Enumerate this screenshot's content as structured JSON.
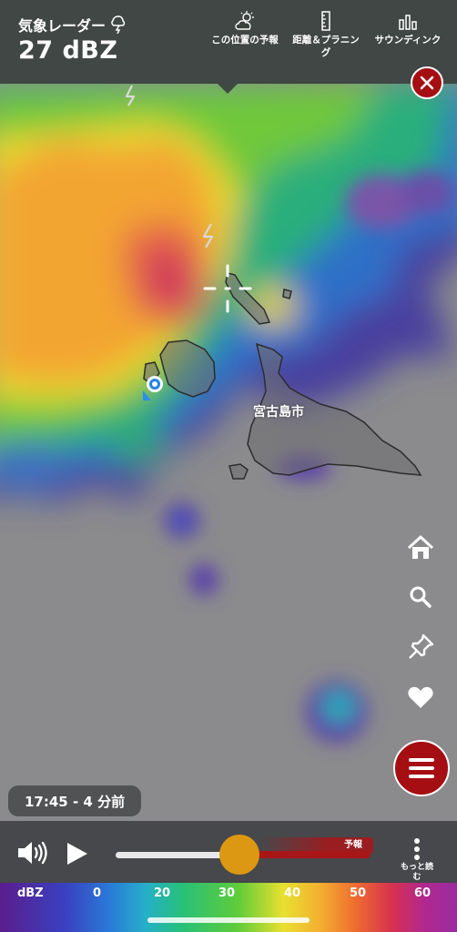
{
  "header": {
    "title": "気象レーダー",
    "value": "27 dBZ",
    "actions": {
      "forecast": "この位置の予報",
      "distance_line1": "距離＆プラニン",
      "distance_line2": "グ",
      "sounding": "サウンディンク"
    }
  },
  "map": {
    "city_label": "宮古島市"
  },
  "time_label": "17:45 - 4 分前",
  "player": {
    "forecast_label": "予報",
    "more_line1": "もっと読",
    "more_line2": "む",
    "position": 0.49
  },
  "legend": {
    "unit": "dBZ",
    "ticks": [
      "0",
      "20",
      "30",
      "40",
      "50",
      "60"
    ]
  },
  "colors": {
    "accent_red": "#a50e12",
    "slider_thumb": "#dc9812"
  },
  "icons": [
    "lightning-icon",
    "cloud-sun-icon",
    "ruler-icon",
    "bar-chart-icon",
    "close-icon",
    "home-icon",
    "search-icon",
    "pin-icon",
    "heart-icon",
    "hamburger-menu-icon",
    "speaker-icon",
    "play-icon",
    "more-vertical-icon",
    "crosshair-icon",
    "location-dot-icon"
  ]
}
